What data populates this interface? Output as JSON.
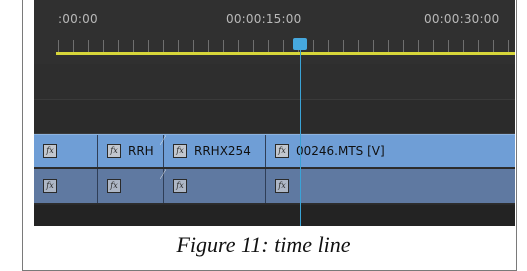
{
  "timeline": {
    "timecodes": [
      ":00:00",
      "00:00:15:00",
      "00:00:30:00"
    ],
    "video_clips": [
      {
        "label": "",
        "fx": "fx"
      },
      {
        "label": "RRH",
        "fx": "fx"
      },
      {
        "label": "RRHX254",
        "fx": "fx"
      },
      {
        "label": "00246.MTS [V]",
        "fx": "fx"
      }
    ],
    "audio_clips": [
      {
        "fx": "fx"
      },
      {
        "fx": "fx"
      },
      {
        "fx": "fx"
      },
      {
        "fx": "fx"
      }
    ],
    "colors": {
      "panel_bg": "#2a2a2a",
      "video_track": "#6f9ed6",
      "audio_track": "#5f79a1",
      "playhead": "#3aa3d6",
      "work_area_bar": "#d7d63a"
    },
    "icons": [
      "fx-effect-icon",
      "playhead-icon",
      "transition-marker-icon"
    ]
  },
  "caption": "Figure 11: time line"
}
